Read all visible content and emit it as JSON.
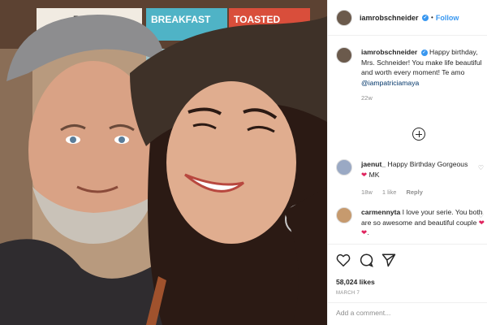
{
  "photo": {
    "signs": [
      "BOWLS",
      "BREAKFAST",
      "TOASTED"
    ]
  },
  "header": {
    "username": "iamrobschneider",
    "dot": "•",
    "follow_label": "Follow",
    "verified_glyph": "✓"
  },
  "caption": {
    "username": "iamrobschneider",
    "text": "Happy birthday, Mrs. Schneider! You make life beautiful and worth every moment! Te amo",
    "mention": "@iampatriciamaya",
    "timestamp": "22w"
  },
  "comments": [
    {
      "username": "jaenut_",
      "text": "Happy Birthday Gorgeous",
      "emoji": "❤",
      "suffix": "MK",
      "time": "18w",
      "likes": "1 like",
      "reply": "Reply"
    },
    {
      "username": "carmennyta",
      "text": "I love your serie. You both are so awesome and beautiful couple",
      "emoji": "❤ ❤",
      "end": "."
    }
  ],
  "actions": {
    "likes": "58,024 likes",
    "date": "MARCH 7"
  },
  "add_comment": {
    "placeholder": "Add a comment..."
  },
  "icons": [
    "more-comments-icon",
    "heart-icon",
    "comment-icon",
    "share-icon",
    "comment-like-icon",
    "verified-badge-icon"
  ],
  "colors": {
    "link_blue": "#3897f0",
    "mention_blue": "#003569",
    "heart_red": "#e0245e",
    "muted_gray": "#8e8e8e",
    "text_dark": "#262626"
  }
}
